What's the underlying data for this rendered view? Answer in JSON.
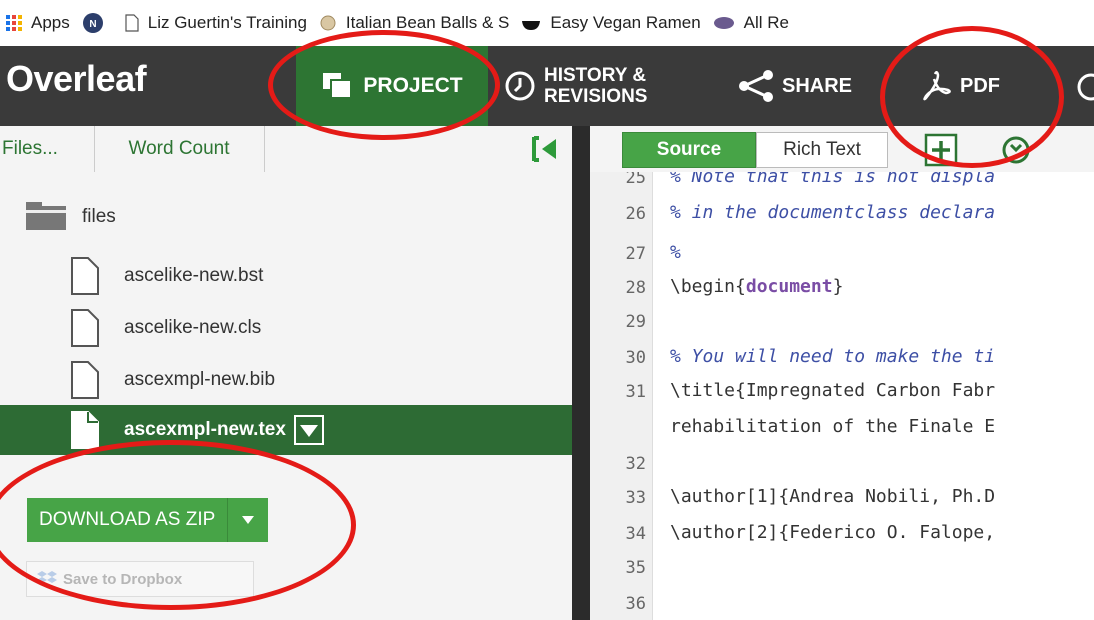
{
  "bookmarks": [
    {
      "label": "Apps",
      "icon": "apps-grid-icon"
    },
    {
      "label": "",
      "icon": "nih-logo-icon"
    },
    {
      "label": "Liz Guertin's Training",
      "icon": "page-icon"
    },
    {
      "label": "Italian Bean Balls & S",
      "icon": "recipe-icon"
    },
    {
      "label": "Easy Vegan Ramen",
      "icon": "bowl-icon"
    },
    {
      "label": "All Re",
      "icon": "globe-icon"
    }
  ],
  "toolbar": {
    "logo": "Overleaf",
    "project": "PROJECT",
    "history_line1": "HISTORY &",
    "history_line2": "REVISIONS",
    "share": "SHARE",
    "pdf": "PDF"
  },
  "left_panel": {
    "files_button": "Files...",
    "word_count_button": "Word Count",
    "folder": "files",
    "files": [
      "ascelike-new.bst",
      "ascelike-new.cls",
      "ascexmpl-new.bib",
      "ascexmpl-new.tex"
    ],
    "active_file": "ascexmpl-new.tex",
    "download": "DOWNLOAD AS ZIP",
    "dropbox": "Save to Dropbox"
  },
  "editor": {
    "tab_source": "Source",
    "tab_rich": "Rich Text",
    "line_numbers": [
      "25",
      "26",
      "27",
      "28",
      "29",
      "30",
      "31",
      "32",
      "33",
      "34",
      "35",
      "36"
    ],
    "line25": "% Note that this is not displa",
    "line26": "% in the documentclass declara",
    "line27": "%",
    "line28_cmd": "\\begin{",
    "line28_arg": "document",
    "line28_end": "}",
    "line30": "% You will need to make the ti",
    "line31a": "\\title{Impregnated Carbon Fabr",
    "line31b": "rehabilitation of the Finale E",
    "line33": "\\author[1]{Andrea Nobili, Ph.D",
    "line34": "\\author[2]{Federico O. Falope,"
  },
  "colors": {
    "overleaf_green": "#2d7533",
    "toolbar_dark": "#3a3a3a",
    "annotation_red": "#e41b17"
  }
}
